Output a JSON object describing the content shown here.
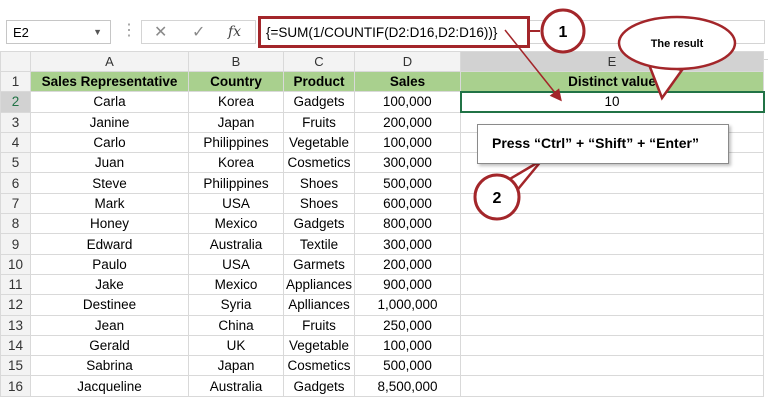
{
  "formula_bar": {
    "name_box": "E2",
    "formula": "{=SUM(1/COUNTIF(D2:D16,D2:D16))}"
  },
  "columns": [
    "A",
    "B",
    "C",
    "D",
    "E"
  ],
  "headers": {
    "row_number": "1",
    "a": "Sales Representative",
    "b": "Country",
    "c": "Product",
    "d": "Sales",
    "e": "Distinct value"
  },
  "rows": [
    {
      "n": "2",
      "a": "Carla",
      "b": "Korea",
      "c": "Gadgets",
      "d": "100,000",
      "e": "10"
    },
    {
      "n": "3",
      "a": "Janine",
      "b": "Japan",
      "c": "Fruits",
      "d": "200,000",
      "e": ""
    },
    {
      "n": "4",
      "a": "Carlo",
      "b": "Philippines",
      "c": "Vegetable",
      "d": "100,000",
      "e": ""
    },
    {
      "n": "5",
      "a": "Juan",
      "b": "Korea",
      "c": "Cosmetics",
      "d": "300,000",
      "e": ""
    },
    {
      "n": "6",
      "a": "Steve",
      "b": "Philippines",
      "c": "Shoes",
      "d": "500,000",
      "e": ""
    },
    {
      "n": "7",
      "a": "Mark",
      "b": "USA",
      "c": "Shoes",
      "d": "600,000",
      "e": ""
    },
    {
      "n": "8",
      "a": "Honey",
      "b": "Mexico",
      "c": "Gadgets",
      "d": "800,000",
      "e": ""
    },
    {
      "n": "9",
      "a": "Edward",
      "b": "Australia",
      "c": "Textile",
      "d": "300,000",
      "e": ""
    },
    {
      "n": "10",
      "a": "Paulo",
      "b": "USA",
      "c": "Garmets",
      "d": "200,000",
      "e": ""
    },
    {
      "n": "11",
      "a": "Jake",
      "b": "Mexico",
      "c": "Appliances",
      "d": "900,000",
      "e": ""
    },
    {
      "n": "12",
      "a": "Destinee",
      "b": "Syria",
      "c": "Aplliances",
      "d": "1,000,000",
      "e": ""
    },
    {
      "n": "13",
      "a": "Jean",
      "b": "China",
      "c": "Fruits",
      "d": "250,000",
      "e": ""
    },
    {
      "n": "14",
      "a": "Gerald",
      "b": "UK",
      "c": "Vegetable",
      "d": "100,000",
      "e": ""
    },
    {
      "n": "15",
      "a": "Sabrina",
      "b": "Japan",
      "c": "Cosmetics",
      "d": "500,000",
      "e": ""
    },
    {
      "n": "16",
      "a": "Jacqueline",
      "b": "Australia",
      "c": "Gadgets",
      "d": "8,500,000",
      "e": ""
    }
  ],
  "annotations": {
    "badge_1": "1",
    "badge_2": "2",
    "result_label": "The result",
    "instruction": "Press “Ctrl” + “Shift” + “Enter”"
  },
  "icons": {
    "cancel": "✕",
    "enter": "✓",
    "function": "fx",
    "dropdown": "▼",
    "separator": "⋮"
  },
  "colors": {
    "header_fill": "#a9d08e",
    "annotation_red": "#a3262a",
    "selection_green": "#217346"
  }
}
